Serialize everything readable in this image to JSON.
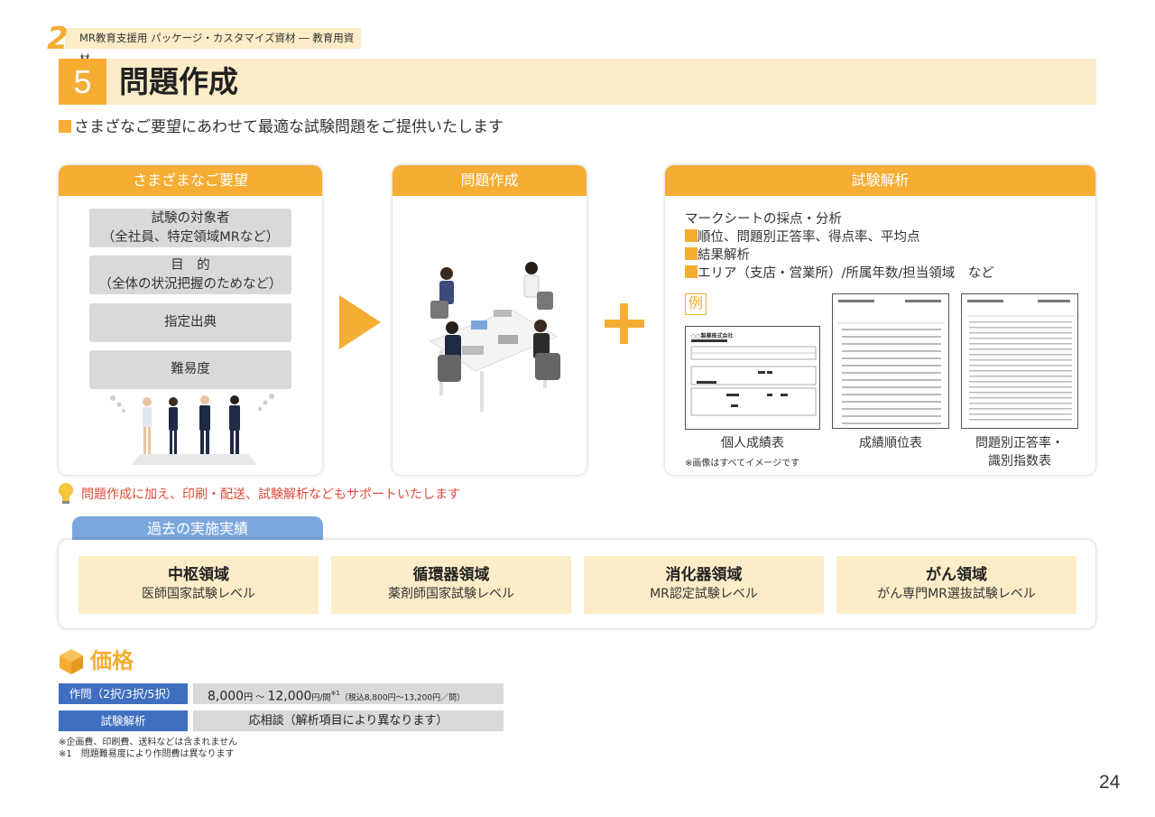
{
  "header": {
    "chapter_number": "2",
    "chapter_label": "MR教育支援用 パッケージ・カスタマイズ資材 ― 教育用資材",
    "section_number": "5",
    "section_title": "問題作成"
  },
  "lead": "さまざなご要望にあわせて最適な試験問題をご提供いたします",
  "requests_panel": {
    "title": "さまざまなご要望",
    "items": [
      {
        "line1": "試験の対象者",
        "line2": "（全社員、特定領域MRなど）"
      },
      {
        "line1": "目　的",
        "line2": "（全体の状況把握のためなど）"
      },
      {
        "line1": "指定出典",
        "line2": ""
      },
      {
        "line1": "難易度",
        "line2": ""
      }
    ]
  },
  "creation_panel": {
    "title": "問題作成"
  },
  "analysis_panel": {
    "title": "試験解析",
    "lines": [
      "マークシートの採点・分析",
      "順位、問題別正答率、得点率、平均点",
      "結果解析",
      "エリア（支店・営業所）/所属年数/担当領域　など"
    ],
    "example_label": "例",
    "docs": [
      {
        "caption": "個人成績表",
        "doc_title": "○○製薬株式会社"
      },
      {
        "caption": "成績順位表",
        "doc_title": ""
      },
      {
        "caption": "問題別正答率・\n識別指数表",
        "doc_title": ""
      }
    ],
    "image_note": "※画像はすべてイメージです"
  },
  "support_note": "問題作成に加え、印刷・配送、試験解析などもサポートいたします",
  "past_results": {
    "title": "過去の実施実績",
    "items": [
      {
        "area": "中枢領域",
        "level": "医師国家試験レベル"
      },
      {
        "area": "循環器領域",
        "level": "薬剤師国家試験レベル"
      },
      {
        "area": "消化器領域",
        "level": "MR認定試験レベル"
      },
      {
        "area": "がん領域",
        "level": "がん専門MR選抜試験レベル"
      }
    ]
  },
  "price": {
    "title": "価格",
    "rows": [
      {
        "label": "作問（2択/3択/5択）",
        "value_main": "8,000",
        "value_unit1": "円 ～ ",
        "value_main2": "12,000",
        "value_unit2": "円/問",
        "value_sup": "※1",
        "value_tax": "（税込8,800円～13,200円／問）"
      },
      {
        "label": "試験解析",
        "value": "応相談（解析項目により異なります）"
      }
    ],
    "notes": [
      "※企画費、印刷費、送料などは含まれません",
      "※1　問題難易度により作問費は異なります"
    ]
  },
  "page_number": "24",
  "colors": {
    "accent": "#f5ad33",
    "accent_light": "#fdecc8",
    "blue": "#3f6fbf",
    "blue_light": "#7ba7dd",
    "note_red": "#e04a3a"
  }
}
